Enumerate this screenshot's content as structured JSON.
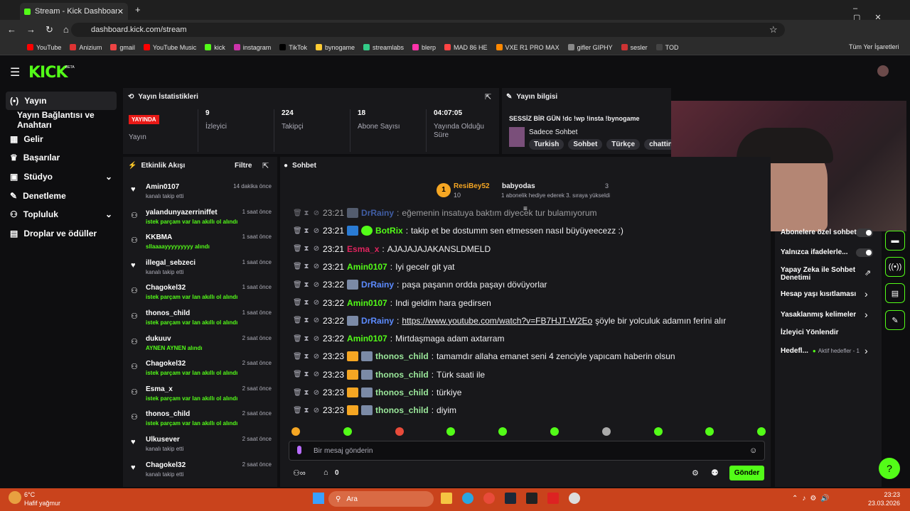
{
  "browser": {
    "tab_title": "Stream - Kick Dashboard",
    "url": "dashboard.kick.com/stream",
    "bookmarks": [
      "YouTube",
      "Anizium",
      "gmail",
      "YouTube Music",
      "kick",
      "instagram",
      "TikTok",
      "bynogame",
      "streamlabs",
      "blerp",
      "MAD 86 HE",
      "VXE R1 PRO MAX",
      "gifler GIPHY",
      "sesler",
      "TOD"
    ],
    "all_bookmarks": "Tüm Yer İşaretleri"
  },
  "brand": {
    "logo": "KICK",
    "beta": "BETA"
  },
  "sidebar": {
    "items": [
      {
        "label": "Yayın"
      },
      {
        "label": "Yayın Bağlantısı ve Anahtarı"
      },
      {
        "label": "Gelir"
      },
      {
        "label": "Başarılar"
      },
      {
        "label": "Stüdyo"
      },
      {
        "label": "Denetleme"
      },
      {
        "label": "Topluluk"
      },
      {
        "label": "Droplar ve ödüller"
      }
    ]
  },
  "stats": {
    "title": "Yayın İstatistikleri",
    "live_badge": "YAYINDA",
    "live_label": "Yayın",
    "viewers": {
      "value": "9",
      "label": "İzleyici"
    },
    "followers": {
      "value": "224",
      "label": "Takipçi"
    },
    "subs": {
      "value": "18",
      "label": "Abone Sayısı"
    },
    "uptime": {
      "value": "04:07:05",
      "label": "Yayında Olduğu Süre"
    }
  },
  "stream_info": {
    "title": "Yayın bilgisi",
    "stream_title": "SESSİZ BİR GÜN !dc !wp !insta !bynogame",
    "category": "Sadece Sohbet",
    "tags": [
      "Turkish",
      "Sohbet",
      "Türkçe",
      "chatting"
    ]
  },
  "activity": {
    "title": "Etkinlik Akışı",
    "filter": "Filtre",
    "items": [
      {
        "name": "Amin0107",
        "time": "14 dakika önce",
        "sub": "kanalı takip etti",
        "green": false
      },
      {
        "name": "yalandunyazerriniffet",
        "time": "1 saat önce",
        "sub": "istek parçam var lan akıllı ol alındı",
        "green": true
      },
      {
        "name": "KKBMA",
        "time": "1 saat önce",
        "sub": "sllaaaayyyyyyyyy alındı",
        "green": true
      },
      {
        "name": "illegal_sebzeci",
        "time": "1 saat önce",
        "sub": "kanalı takip etti",
        "green": false
      },
      {
        "name": "Chagokel32",
        "time": "1 saat önce",
        "sub": "istek parçam var lan akıllı ol alındı",
        "green": true
      },
      {
        "name": "thonos_child",
        "time": "1 saat önce",
        "sub": "istek parçam var lan akıllı ol alındı",
        "green": true
      },
      {
        "name": "dukuuv",
        "time": "2 saat önce",
        "sub": "AYNEN AYNEN alındı",
        "green": true
      },
      {
        "name": "Chagokel32",
        "time": "2 saat önce",
        "sub": "istek parçam var lan akıllı ol alındı",
        "green": true
      },
      {
        "name": "Esma_x",
        "time": "2 saat önce",
        "sub": "istek parçam var lan akıllı ol alındı",
        "green": true
      },
      {
        "name": "thonos_child",
        "time": "2 saat önce",
        "sub": "istek parçam var lan akıllı ol alındı",
        "green": true
      },
      {
        "name": "Ulkusever",
        "time": "2 saat önce",
        "sub": "kanalı takip etti",
        "green": false
      },
      {
        "name": "Chagokel32",
        "time": "2 saat önce",
        "sub": "kanalı takip etti",
        "green": false
      }
    ]
  },
  "chat": {
    "title": "Sohbet",
    "top_gifter": "ResiBey52",
    "top_gifter_count": "10",
    "gift_user": "babyodas",
    "gift_count": "3",
    "gift_note": "1 abonelik hediye ederek 3. sıraya yükseldi",
    "messages": [
      {
        "time": "23:21",
        "user": "DrRainy",
        "color": "#5c8bff",
        "text": "eğemenin insatuya baktım diyecek tur bulamıyorum"
      },
      {
        "time": "23:21",
        "user": "BotRix",
        "color": "#53fc18",
        "text": "takip et be dostumm sen etmessen nasıl büyüyeecezz :)"
      },
      {
        "time": "23:21",
        "user": "Esma_x",
        "color": "#e0245e",
        "text": "AJAJAJAJAKANSLDMELD"
      },
      {
        "time": "23:21",
        "user": "Amin0107",
        "color": "#53fc18",
        "text": "Iyi gecelr git yat"
      },
      {
        "time": "23:22",
        "user": "DrRainy",
        "color": "#5c8bff",
        "text": "paşa paşanın ordda paşayı dövüyorlar"
      },
      {
        "time": "23:22",
        "user": "Amin0107",
        "color": "#53fc18",
        "text": "Indi geldim hara gedirsen"
      },
      {
        "time": "23:22",
        "user": "DrRainy",
        "color": "#5c8bff",
        "link": "https://www.youtube.com/watch?v=FB7HJT-W2Eo",
        "text": "şöyle bir yolculuk adamın ferini alır"
      },
      {
        "time": "23:22",
        "user": "Amin0107",
        "color": "#53fc18",
        "text": "Mirtdaşmaga adam axtarram"
      },
      {
        "time": "23:23",
        "user": "thonos_child",
        "color": "#9be89b",
        "text": "tamamdır allaha emanet seni 4 zenciyle yapıcam haberin olsun"
      },
      {
        "time": "23:23",
        "user": "thonos_child",
        "color": "#9be89b",
        "text": "Türk saati ile"
      },
      {
        "time": "23:23",
        "user": "thonos_child",
        "color": "#9be89b",
        "text": "türkiye"
      },
      {
        "time": "23:23",
        "user": "thonos_child",
        "color": "#9be89b",
        "text": "diyim"
      }
    ],
    "placeholder": "Bir mesaj gönderin",
    "send": "Gönder",
    "points": "0"
  },
  "mod": {
    "items": [
      {
        "label": "Abonelere özel sohbet"
      },
      {
        "label": "Yalnızca ifadelerle..."
      },
      {
        "label": "Yapay Zeka ile Sohbet Denetimi"
      },
      {
        "label": "Hesap yaşı kısıtlaması"
      },
      {
        "label": "Yasaklanmış kelimeler"
      },
      {
        "label": "İzleyici Yönlendir"
      },
      {
        "label": "Hedefl..."
      }
    ],
    "goals_sub": "Aktif hedefler - 1"
  },
  "taskbar": {
    "temp": "6°C",
    "weather": "Hafif yağmur",
    "search": "Ara",
    "time": "23:23",
    "date": "23.03.2026"
  },
  "colors": {
    "accent": "#53fc18",
    "live": "#e91916",
    "panel": "#18181b"
  }
}
